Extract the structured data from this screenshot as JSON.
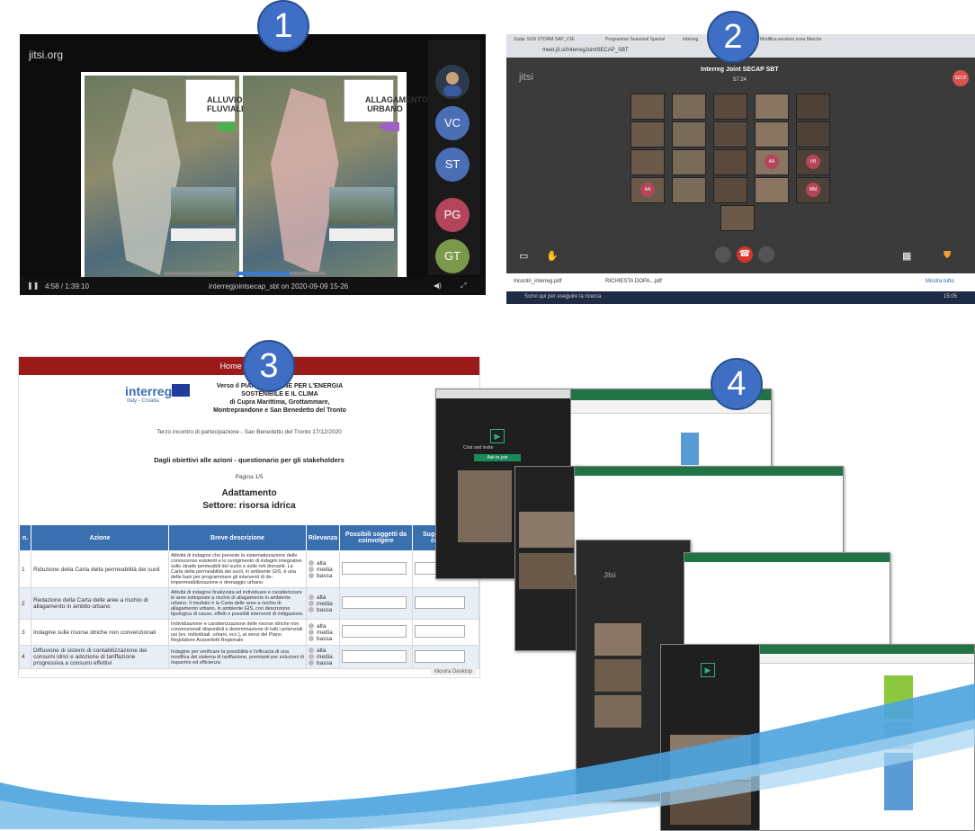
{
  "badges": [
    "1",
    "2",
    "3",
    "4"
  ],
  "panel1": {
    "brand": "jitsi.org",
    "map_label_1": "ALLUVIONE FLUVIALE",
    "map_label_2": "ALLAGAMENTO URBANO",
    "participants": [
      {
        "initials": "VC",
        "color": "#4a6fb5"
      },
      {
        "initials": "ST",
        "color": "#4a6fb5"
      },
      {
        "initials": "PG",
        "color": "#b5455a"
      },
      {
        "initials": "GT",
        "color": "#7a9a4a"
      }
    ],
    "time": "4:58 / 1:39:10",
    "filename": "interregjointsecap_sbt on 2020-09-09 15-26"
  },
  "panel2": {
    "tabs": [
      "Zadar SUN STORM SAP_VJE",
      "Programme Seasonal Special",
      "Interreg",
      "Modifica sessioni zona Marche"
    ],
    "url": "meet.jit.si/InterregJointSECAP_SBT",
    "brand": "jitsi",
    "meeting_title": "Interreg Joint SECAP SBT",
    "timer": "57:24",
    "user_badge": "SECF",
    "initials_tiles": [
      "AA",
      "VB",
      "AA",
      "MM"
    ],
    "downloads": [
      "Incontri_interreg.pdf",
      "RICHIESTA DOPA...pdf"
    ],
    "show_all": "Mostra tutto",
    "search": "Scrivi qui per eseguire la ricerca",
    "clock": "15:05"
  },
  "panel3": {
    "nav": "Home | Accesso",
    "logo": "interreg",
    "logo_sub": "Italy - Croatia",
    "heading_1": "Verso il PIANO D'AZIONE PER L'ENERGIA",
    "heading_2": "SOSTENIBILE E IL CLIMA",
    "heading_3": "di Cupra Marittima, Grottammare,",
    "heading_4": "Montreprandone e San Benedetto del Tronto",
    "meeting": "Terzo incontro di partecipazione - San Benedetto del Tronto 17/12/2020",
    "subtitle": "Dagli obiettivi alle azioni - questionario per gli stakeholders",
    "page": "Pagina 1/5",
    "section": "Adattamento",
    "sector": "Settore: risorsa idrica",
    "columns": [
      "n.",
      "Azione",
      "Breve descrizione",
      "Rilevanza",
      "Possibili soggetti da coinvolgere",
      "Suggerimenti o commenti"
    ],
    "rilevanza": [
      "alta",
      "media",
      "bassa"
    ],
    "rows": [
      {
        "n": "1",
        "azione": "Riduzione della Carta della permeabilità dei suoli",
        "desc": "Attività di indagine che prevede la sistematizzazione delle conoscenze esistenti e lo svolgimento di indagini integrative sulle strade permeabili del suolo e sulle reti drenanti. La Carta della permeabilità dei suoli, in ambiente GIS, è una delle basi per programmare gli interventi di de-impermeabilizzazione e drenaggio urbano."
      },
      {
        "n": "2",
        "azione": "Redazione della Carta delle aree a rischio di allagamento in ambito urbano",
        "desc": "Attività di indagine finalizzata ad individuare e caratterizzare le aree sottoposte a rischio di allagamento in ambiente urbano. Il risultato è la Carta delle aree a rischio di allagamento urbano, in ambiente GIS, con descrizione tipologica di cause, effetti e possibili interventi di mitigazione."
      },
      {
        "n": "3",
        "azione": "Indagine sulle risorse idriche non convenzionali",
        "desc": "Individuazione e caratterizzazione delle risorse idriche non convenzionali disponibili e determinazione di tutti i potenziali usi (es. individuali, urbani, ecc.), ai sensi del Piano Regolatore Acquedotti Regionale"
      },
      {
        "n": "4",
        "azione": "Diffusione di sistemi di contabilizzazione dei consumi idrici e adozione di tariffazione progressiva a consumi effettivi",
        "desc": "Indagine per verificare la possibilità e l'efficacia di una modifica del sistema di tariffazione, premianti per soluzioni di risparmio ed efficienza"
      }
    ],
    "footer": "Mostra Desktop"
  },
  "panel4": {
    "meet_text": "Chat and invite",
    "join_button": "Ask to join",
    "jitsi": "Jitsi"
  }
}
